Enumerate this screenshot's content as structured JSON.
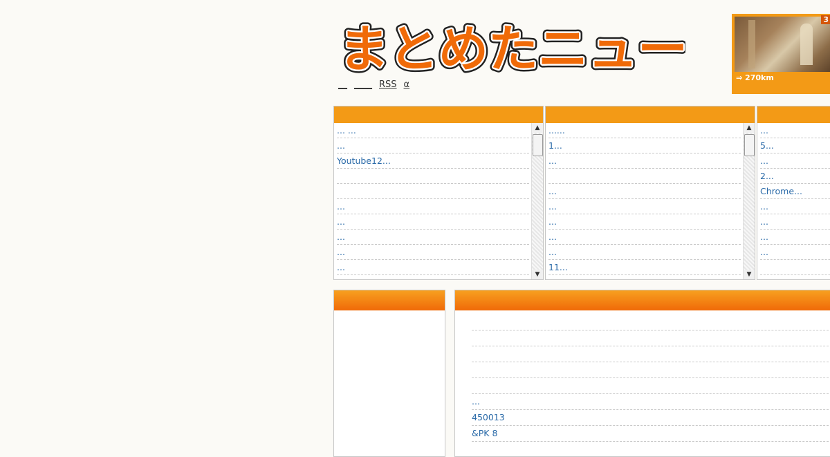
{
  "header": {
    "logo_text": "まとめたニュース",
    "nav": [
      "__",
      "____",
      "RSS",
      "α"
    ]
  },
  "feature": {
    "badge": "3",
    "caption": "⇒ 270km"
  },
  "columns": [
    {
      "items": [
        "... ...",
        "...",
        "Youtube12...",
        "",
        "",
        "...",
        "...",
        "...",
        " ...",
        "..."
      ]
    },
    {
      "items": [
        "......",
        "1...",
        "...",
        "",
        "...",
        "...",
        "...",
        "...",
        "...",
        "11...",
        "..."
      ]
    },
    {
      "items": [
        "...",
        "5...",
        "...",
        "2...",
        "Chrome...",
        "...",
        "...",
        "...",
        "...",
        ""
      ]
    }
  ],
  "main_list": [
    "",
    "",
    "",
    "",
    "",
    "...",
    " 450013",
    "&PK   8"
  ],
  "colors": {
    "accent": "#f39a16",
    "accent_dark": "#f06a08",
    "link": "#2a6aa8"
  }
}
